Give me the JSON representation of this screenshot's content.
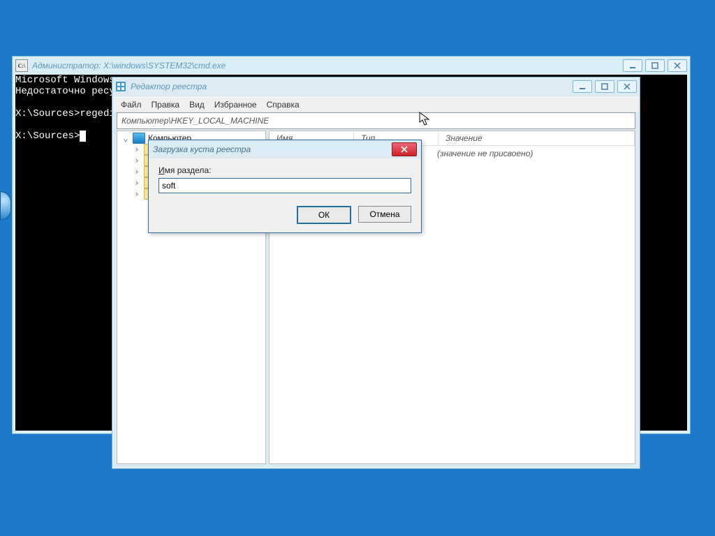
{
  "cmd": {
    "title": "Администратор: X:\\windows\\SYSTEM32\\cmd.exe",
    "lines": [
      "Microsoft Windows",
      "Недостаточно ресу",
      "",
      "X:\\Sources>regedi",
      "",
      "X:\\Sources>"
    ],
    "min_tip": "Свернуть",
    "max_tip": "Развернуть",
    "close_tip": "Закрыть"
  },
  "reg": {
    "title": "Редактор реестра",
    "menu": {
      "file": "Файл",
      "edit": "Правка",
      "view": "Вид",
      "fav": "Избранное",
      "help": "Справка"
    },
    "address": "Компьютер\\HKEY_LOCAL_MACHINE",
    "tree_header": "Компьютер",
    "tree_children_count": 5,
    "list_headers": {
      "name": "Имя",
      "type": "Тип",
      "value": "Значение"
    },
    "list_placeholder": "(значение не присвоено)"
  },
  "dialog": {
    "title": "Загрузка куста реестра",
    "label_prefix": "И",
    "label_rest": "мя раздела:",
    "value": "soft",
    "ok": "ОК",
    "cancel": "Отмена"
  }
}
